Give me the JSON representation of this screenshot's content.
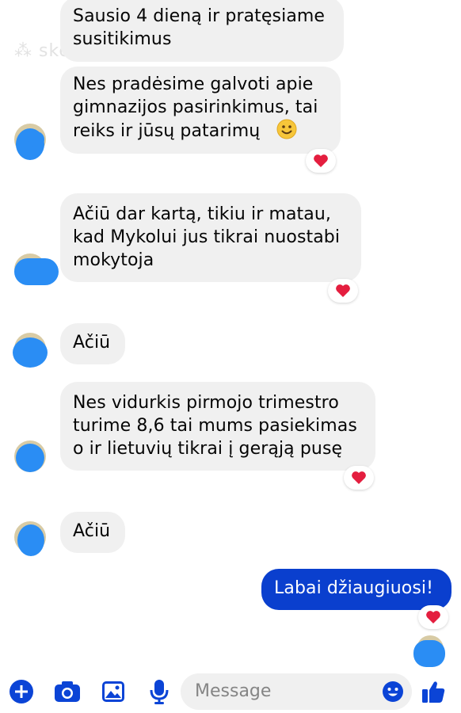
{
  "watermark": "skelbiu.lt",
  "messages": [
    {
      "id": "m1",
      "direction": "in",
      "lines": [
        "Sausio 4 dieną ir pratęsiame",
        "susitikimus"
      ]
    },
    {
      "id": "m2",
      "direction": "in",
      "lines": [
        "Nes pradėsime galvoti apie",
        "gimnazijos pasirinkimus, tai",
        "reiks ir jūsų patarimų"
      ],
      "emoji": "slightly-smiling-face",
      "reaction": "heart"
    },
    {
      "id": "m3",
      "direction": "in",
      "lines": [
        "Ačiū dar kartą, tikiu ir matau,",
        "kad Mykolui jus tikrai nuostabi",
        "mokytoja"
      ],
      "reaction": "heart"
    },
    {
      "id": "m4",
      "direction": "in",
      "lines": [
        "Ačiū"
      ]
    },
    {
      "id": "m5",
      "direction": "in",
      "lines": [
        "Nes vidurkis pirmojo trimestro",
        "turime 8,6 tai mums pasiekimas",
        "o ir lietuvių tikrai į gerąją pusę"
      ],
      "reaction": "heart"
    },
    {
      "id": "m6",
      "direction": "in",
      "lines": [
        "Ačiū"
      ]
    },
    {
      "id": "m7",
      "direction": "out",
      "lines": [
        "Labai džiaugiuosi!"
      ],
      "reaction": "heart"
    }
  ],
  "composer": {
    "placeholder": "Message",
    "icons": [
      "plus-icon",
      "camera-icon",
      "image-icon",
      "microphone-icon",
      "emoji-icon",
      "thumbs-up-icon"
    ]
  },
  "colors": {
    "accent": "#0a3fce",
    "icon": "#0b44d6",
    "incoming_bubble": "#f0f0f0",
    "heart": "#e41e3f"
  }
}
